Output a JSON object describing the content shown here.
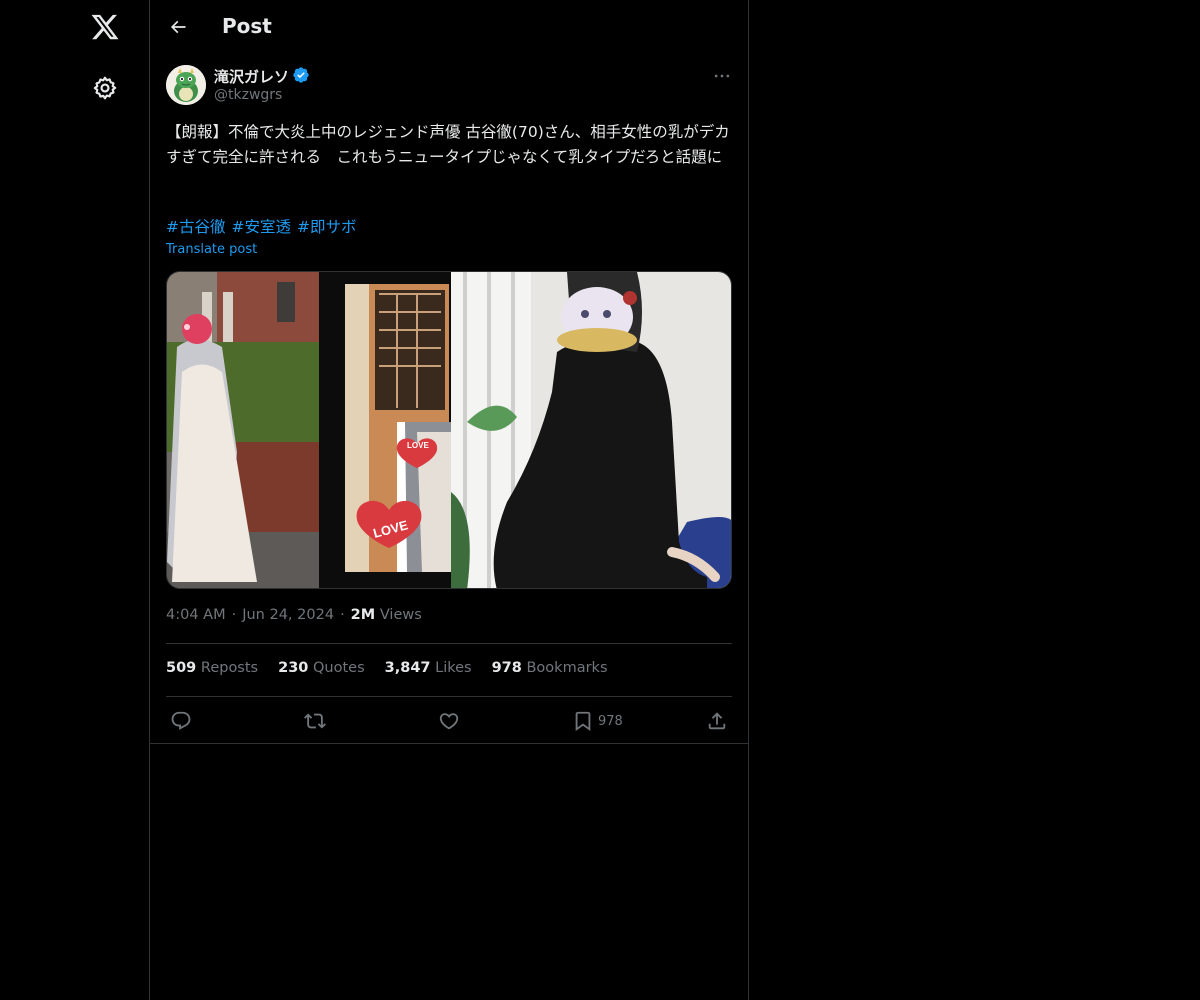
{
  "header": {
    "title": "Post"
  },
  "author": {
    "name": "滝沢ガレソ",
    "handle": "@tkzwgrs"
  },
  "tweet": {
    "text": "【朗報】不倫で大炎上中のレジェンド声優 古谷徹(70)さん、相手女性の乳がデカすぎて完全に許される　これもうニュータイプじゃなくて乳タイプだろと話題に",
    "hashtags": [
      "#古谷徹",
      "#安室透",
      "#即サボ"
    ],
    "translate": "Translate post"
  },
  "meta": {
    "time": "4:04 AM",
    "date": "Jun 24, 2024",
    "views_count": "2M",
    "views_label": "Views",
    "separator": "·"
  },
  "stats": {
    "reposts_count": "509",
    "reposts_label": "Reposts",
    "quotes_count": "230",
    "quotes_label": "Quotes",
    "likes_count": "3,847",
    "likes_label": "Likes",
    "bookmarks_count": "978",
    "bookmarks_label": "Bookmarks"
  },
  "actions": {
    "bookmark_count": "978"
  },
  "media": {
    "stickers": [
      "LOVE",
      "LOVE"
    ]
  },
  "icons": [
    "x-logo-icon",
    "settings-icon",
    "back-arrow-icon",
    "verified-badge-icon",
    "more-icon",
    "reply-icon",
    "repost-icon",
    "like-icon",
    "bookmark-icon",
    "share-icon"
  ],
  "colors": {
    "accent": "#1d9bf0",
    "text": "#e7e9ea",
    "muted": "#71767b",
    "border": "#2f3336",
    "background": "#000000"
  }
}
